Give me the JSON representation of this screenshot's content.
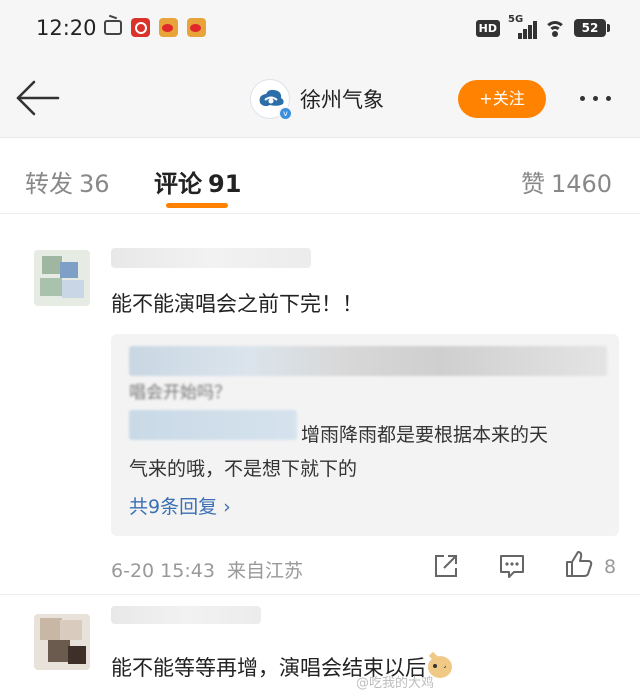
{
  "status_bar": {
    "time": "12:20",
    "network": "5G",
    "battery": "52",
    "hd_badge": "HD"
  },
  "nav": {
    "account_name": "徐州气象",
    "follow_label": "+关注"
  },
  "tabs": {
    "repost_label": "转发",
    "repost_count": "36",
    "comments_label": "评论",
    "comments_count": "91",
    "likes_label": "赞",
    "likes_count": "1460"
  },
  "comments": [
    {
      "text": "能不能演唱会之前下完！！",
      "reply_partial": "唱会开始吗？",
      "reply_line_1": "增雨降雨都是要根据本来的天",
      "reply_line_2": "气来的哦，不是想下就下的",
      "reply_more": "共9条回复 ›",
      "time": "6-20 15:43",
      "location": "来自江苏",
      "like_count": "8"
    },
    {
      "text": "能不能等等再增，演唱会结束以后"
    }
  ],
  "watermark": "@吃我的大鸡"
}
